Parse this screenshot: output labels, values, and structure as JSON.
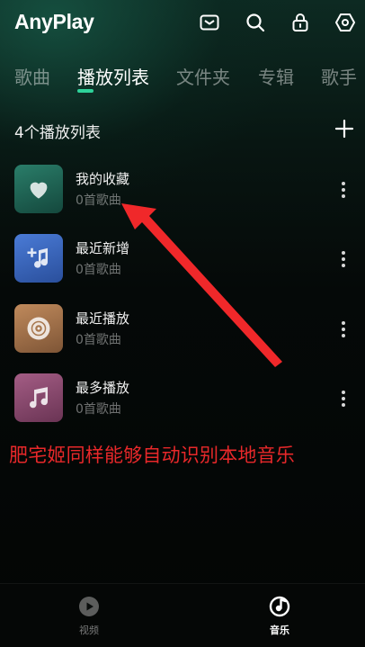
{
  "app": {
    "name": "AnyPlay"
  },
  "topbar": {
    "icons": [
      "mail-icon",
      "search-icon",
      "lock-icon",
      "settings-icon"
    ]
  },
  "tabs": [
    {
      "label": "歌曲",
      "active": false
    },
    {
      "label": "播放列表",
      "active": true
    },
    {
      "label": "文件夹",
      "active": false
    },
    {
      "label": "专辑",
      "active": false
    },
    {
      "label": "歌手",
      "active": false
    }
  ],
  "playlists": {
    "header": "4个播放列表",
    "items": [
      {
        "title": "我的收藏",
        "subtitle": "0首歌曲",
        "icon": "heart-icon",
        "color": "#1f6b5a"
      },
      {
        "title": "最近新增",
        "subtitle": "0首歌曲",
        "icon": "music-add-icon",
        "color": "#3a63b8"
      },
      {
        "title": "最近播放",
        "subtitle": "0首歌曲",
        "icon": "disc-icon",
        "color": "#a8784f"
      },
      {
        "title": "最多播放",
        "subtitle": "0首歌曲",
        "icon": "music-note-icon",
        "color": "#8a4a6e"
      }
    ]
  },
  "annotation": {
    "text": "肥宅姬同样能够自动识别本地音乐",
    "color": "#e8282a"
  },
  "bottom_nav": [
    {
      "label": "视频",
      "active": false,
      "icon": "play-circle-icon"
    },
    {
      "label": "音乐",
      "active": true,
      "icon": "music-disc-icon"
    }
  ],
  "colors": {
    "accent": "#2ed39a",
    "background": "#060a09"
  }
}
